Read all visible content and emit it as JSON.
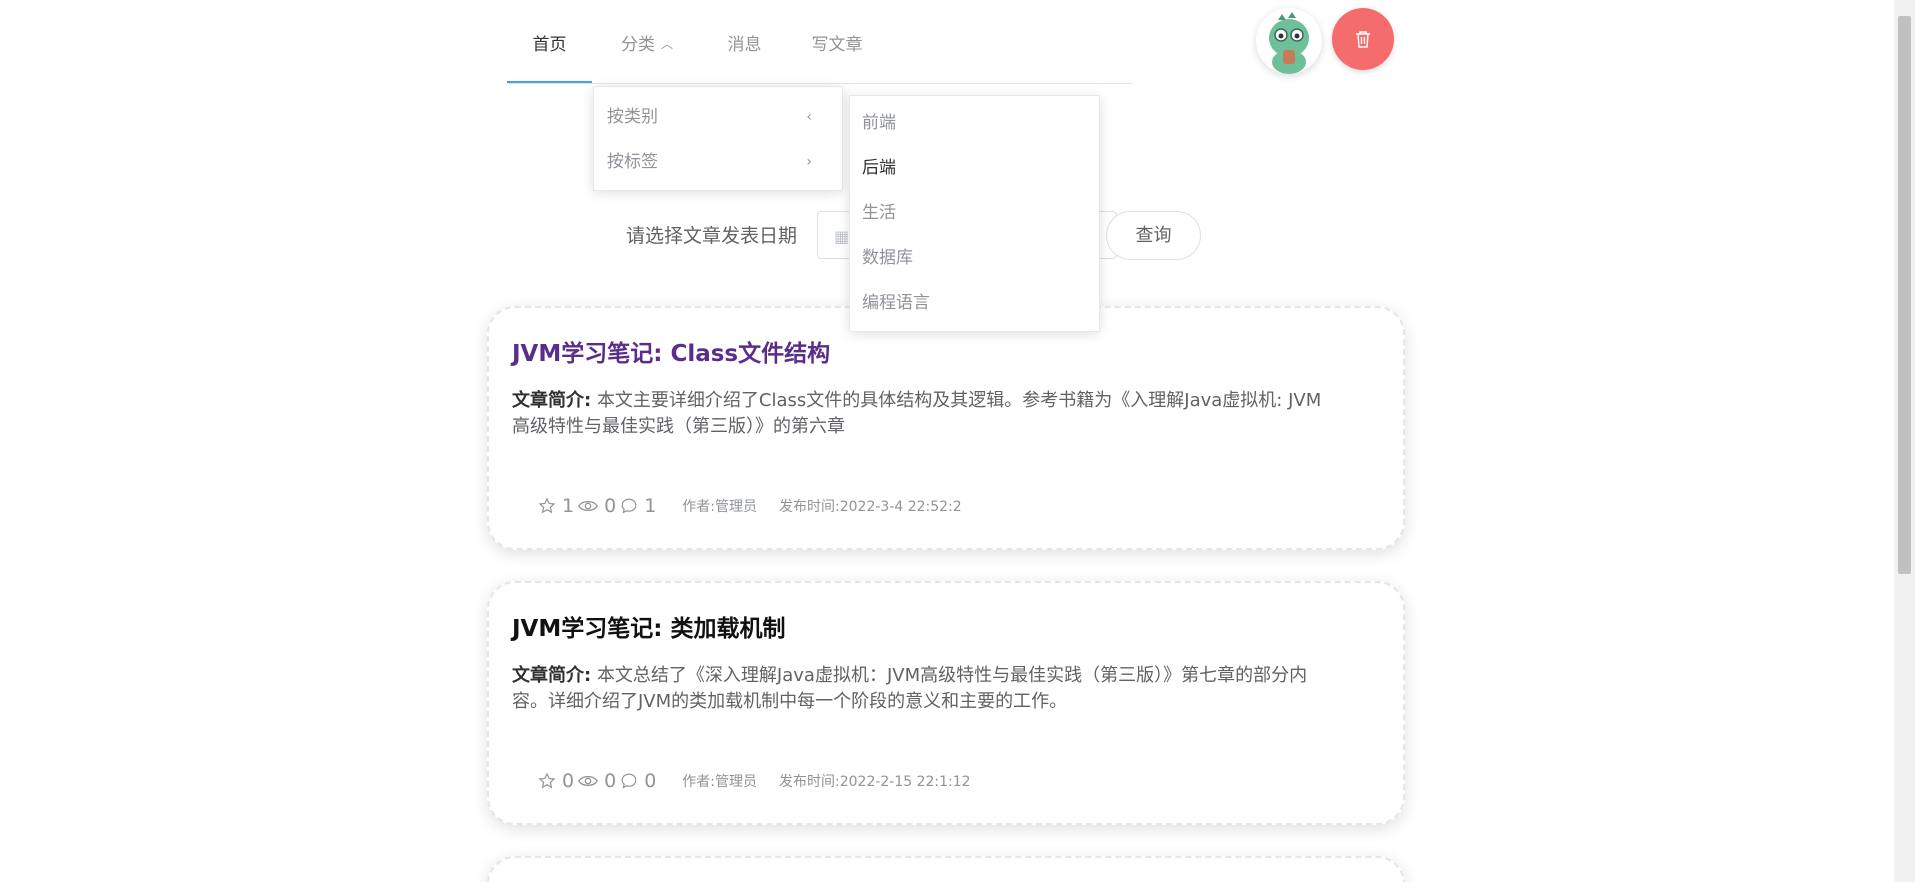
{
  "nav": {
    "items": [
      {
        "label": "首页",
        "active": true
      },
      {
        "label": "分类",
        "has_dropdown": true
      },
      {
        "label": "消息"
      },
      {
        "label": "写文章"
      }
    ]
  },
  "category_menu": {
    "sub_items": [
      {
        "label": "按类别",
        "arrow": "‹"
      },
      {
        "label": "按标签",
        "arrow": "›"
      }
    ],
    "categories": [
      "前端",
      "后端",
      "生活",
      "数据库",
      "编程语言"
    ],
    "hovered": "后端"
  },
  "filter": {
    "date_label": "请选择文章发表日期",
    "query_label": "查询"
  },
  "articles": [
    {
      "title": "JVM学习笔记: Class文件结构",
      "title_color": "#5a2d8c",
      "desc_label": "文章简介:",
      "desc": "本文主要详细介绍了Class文件的具体结构及其逻辑。参考书籍为《入理解Java虚拟机: JVM高级特性与最佳实践（第三版）》的第六章",
      "stars": "1",
      "views": "0",
      "comments": "1",
      "author": "作者:管理员",
      "time": "发布时间:2022-3-4 22:52:2"
    },
    {
      "title": "JVM学习笔记: 类加载机制",
      "title_color": "#111111",
      "desc_label": "文章简介:",
      "desc": "本文总结了《深入理解Java虚拟机：JVM高级特性与最佳实践（第三版）》第七章的部分内容。详细介绍了JVM的类加载机制中每一个阶段的意义和主要的工作。",
      "stars": "0",
      "views": "0",
      "comments": "0",
      "author": "作者:管理员",
      "time": "发布时间:2022-2-15 22:1:12"
    }
  ],
  "colors": {
    "accent": "#409eff",
    "danger": "#f56c6c"
  }
}
